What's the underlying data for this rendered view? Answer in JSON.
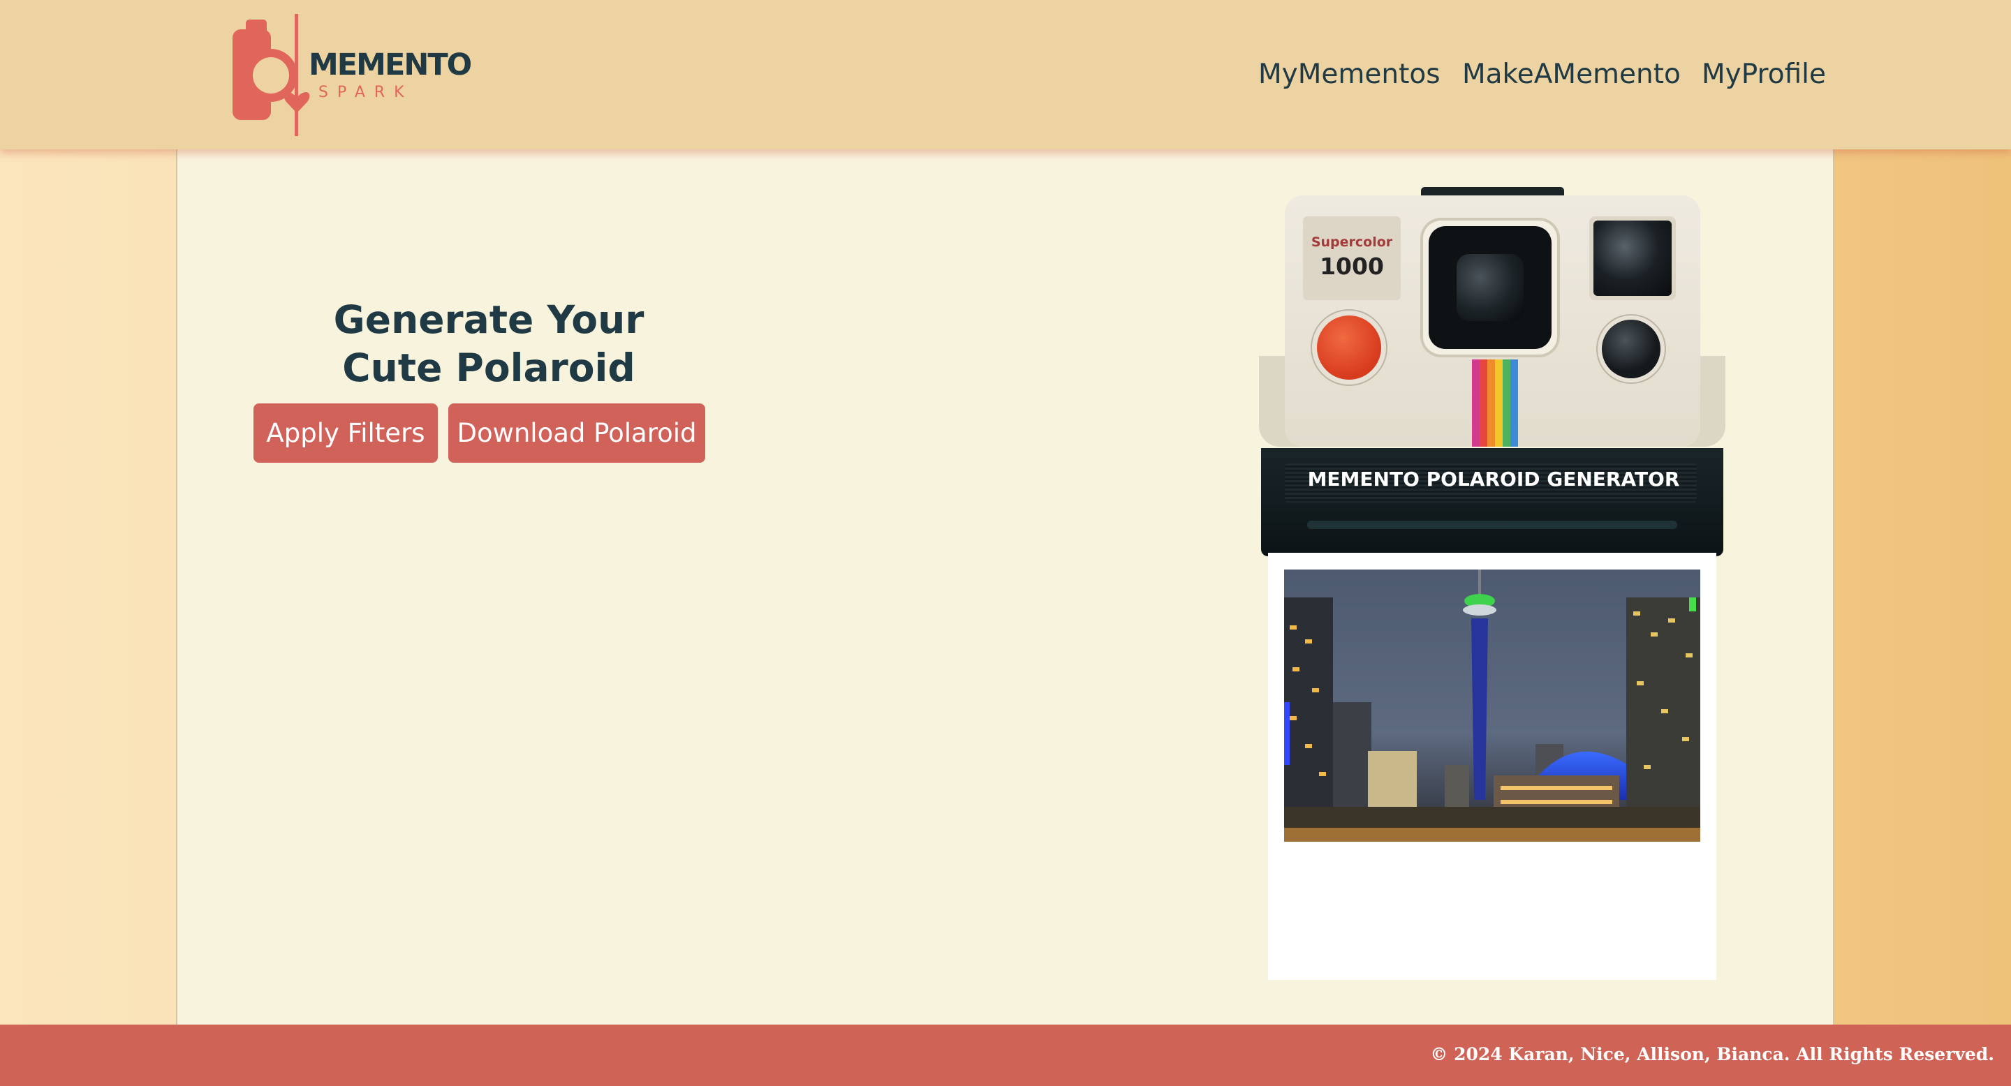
{
  "header": {
    "logo": {
      "title": "MEMENTO",
      "subtitle": "SPARK",
      "brand_color": "#e0665c"
    },
    "nav": [
      "MyMementos",
      "MakeAMemento",
      "MyProfile"
    ]
  },
  "main": {
    "heading": "Generate Your Cute Polaroid",
    "buttons": {
      "apply_filters": "Apply Filters",
      "download_polaroid": "Download Polaroid"
    }
  },
  "camera": {
    "model_small": "Supercolor",
    "model_big": "1000",
    "slot_label": "MEMENTO POLAROID GENERATOR",
    "photo_subject": "city-skyline-night-image"
  },
  "footer": {
    "copyright": "© 2024 Karan, Nice, Allison, Bianca. All Rights Reserved."
  },
  "colors": {
    "header_bg": "#eed3a2",
    "panel_bg": "#f8f3dc",
    "accent": "#d1625a",
    "text_dark": "#1f3a44",
    "footer_bg": "#cf6355"
  }
}
